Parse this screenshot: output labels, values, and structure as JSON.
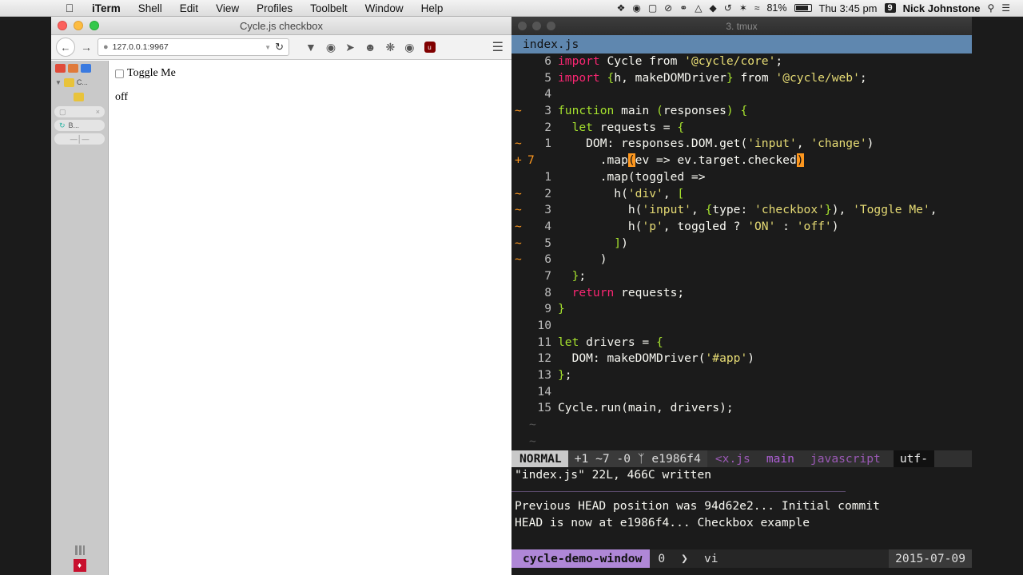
{
  "menubar": {
    "apple_icon": "apple-icon",
    "items": [
      "iTerm",
      "Shell",
      "Edit",
      "View",
      "Profiles",
      "Toolbelt",
      "Window",
      "Help"
    ],
    "battery_percent": "81%",
    "battery_level": 0.81,
    "clock": "Thu 3:45 pm",
    "space_number": "9",
    "user": "Nick Johnstone"
  },
  "browser": {
    "window_title": "Cycle.js checkbox",
    "url": "127.0.0.1:9967",
    "page": {
      "checkbox_label": "Toggle Me",
      "output_text": "off"
    }
  },
  "terminal": {
    "window_title": "3. tmux",
    "vim_tab": "index.js",
    "statusline": {
      "mode": "NORMAL",
      "git_diff": "+1 ~7 -0",
      "commit": "e1986f4",
      "file": "<x.js",
      "function": "main",
      "filetype": "javascript",
      "encoding": "utf-"
    },
    "cmdline": "\"index.js\" 22L, 466C written",
    "output_lines": [
      "Previous HEAD position was 94d62e2... Initial commit",
      "HEAD is now at e1986f4... Checkbox example"
    ],
    "tmux": {
      "session": "cycle-demo-window",
      "window_index": "0",
      "window_name": "vi",
      "date": "2015-07-09"
    }
  },
  "colors": {
    "vim_keyword": "#f92672",
    "vim_string": "#e6db74",
    "vim_paren": "#a6e22e",
    "tab_blue": "#5f87af",
    "tmux_purple": "#af87d7"
  }
}
